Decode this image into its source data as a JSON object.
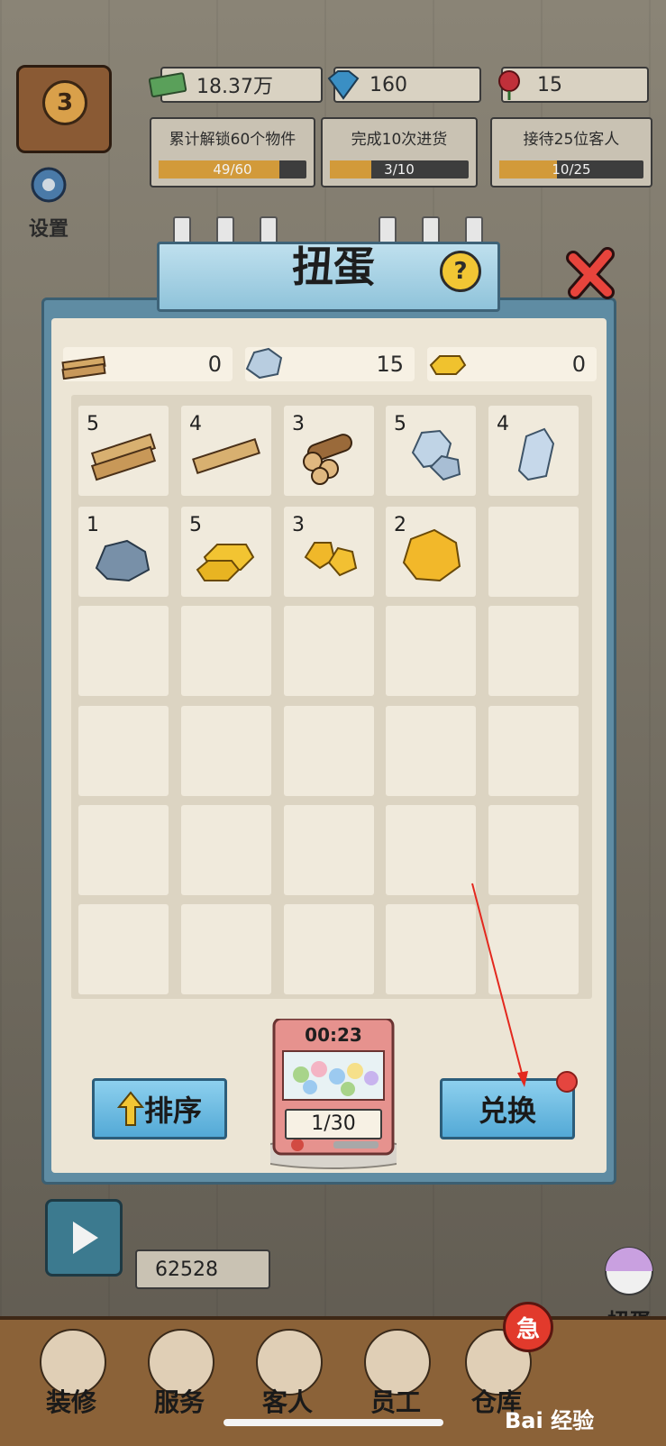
{
  "hud": {
    "level": "3",
    "cash": "18.37万",
    "diamonds": "160",
    "roses": "15",
    "tasks": [
      {
        "label": "累计解锁60个物件",
        "progress": "49/60",
        "fraction": 0.8167
      },
      {
        "label": "完成10次进货",
        "progress": "3/10",
        "fraction": 0.3
      },
      {
        "label": "接待25位客人",
        "progress": "10/25",
        "fraction": 0.4
      }
    ],
    "settings_label": "设置"
  },
  "modal": {
    "title": "扭蛋",
    "resources": [
      {
        "name": "wood-plank-icon",
        "value": "0"
      },
      {
        "name": "stone-icon",
        "value": "15"
      },
      {
        "name": "gold-bar-icon",
        "value": "0"
      }
    ],
    "inventory": [
      {
        "count": "5",
        "icon": "wood-planks-icon"
      },
      {
        "count": "4",
        "icon": "wood-plank-icon"
      },
      {
        "count": "3",
        "icon": "logs-icon"
      },
      {
        "count": "5",
        "icon": "rocks-icon"
      },
      {
        "count": "4",
        "icon": "crystal-rock-icon"
      },
      {
        "count": "1",
        "icon": "stone-icon"
      },
      {
        "count": "5",
        "icon": "gold-bars-icon"
      },
      {
        "count": "3",
        "icon": "gold-nuggets-icon"
      },
      {
        "count": "2",
        "icon": "gold-ore-icon"
      }
    ],
    "sort_label": "排序",
    "exchange_label": "兑换",
    "gacha_timer": "00:23",
    "gacha_count": "1/30"
  },
  "bottom": {
    "money": "62528",
    "gacha_label": "扭蛋",
    "urgent": "急",
    "tabs": [
      "装修",
      "服务",
      "客人",
      "员工",
      "仓库"
    ],
    "watermark": "Bai 经验"
  },
  "colors": {
    "modal_frame": "#5f8ca3",
    "panel": "#ece5d5",
    "button_blue": "#53a9d6",
    "progress_fill": "#d29a3a",
    "alert_red": "#e5453f"
  }
}
